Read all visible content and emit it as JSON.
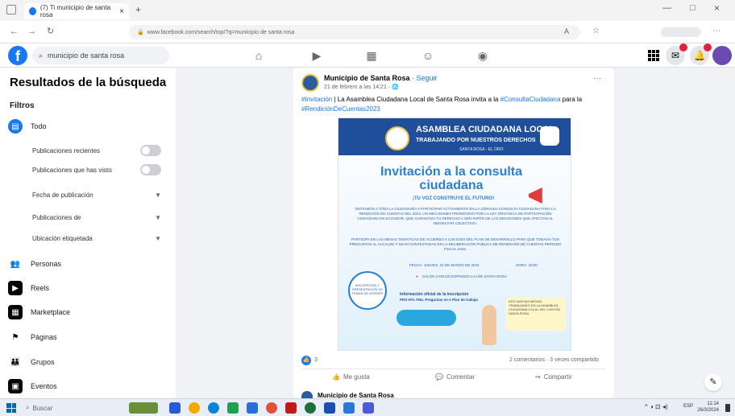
{
  "browser": {
    "tab_title": "(7) Ti municipio de santa rosa",
    "url": "www.facebook.com/search/top/?q=municipio de santa rosa",
    "close_glyph": "×",
    "new_tab_glyph": "+"
  },
  "fb": {
    "logo": "f",
    "search_value": "municipio de santa rosa"
  },
  "sidebar": {
    "title": "Resultados de la búsqueda",
    "filters_label": "Filtros",
    "all_label": "Todo",
    "sub_filters": [
      {
        "label": "Publicaciones recientes",
        "control": "toggle"
      },
      {
        "label": "Publicaciones que has visto",
        "control": "toggle"
      },
      {
        "label": "Fecha de publicación",
        "control": "chevron"
      },
      {
        "label": "Publicaciones de",
        "control": "chevron"
      },
      {
        "label": "Ubicación etiquetada",
        "control": "chevron"
      }
    ],
    "categories": [
      {
        "label": "Personas",
        "icon": "people-icon"
      },
      {
        "label": "Reels",
        "icon": "reels-icon"
      },
      {
        "label": "Marketplace",
        "icon": "marketplace-icon"
      },
      {
        "label": "Páginas",
        "icon": "flag-icon"
      },
      {
        "label": "Grupos",
        "icon": "groups-icon"
      },
      {
        "label": "Eventos",
        "icon": "calendar-icon"
      }
    ]
  },
  "post": {
    "page_name": "Municipio de Santa Rosa",
    "follow_label": "· Seguir",
    "date": "21 de febrero a las 14:21 · 🌐",
    "more_glyph": "···",
    "text_tag1": "#Invitación",
    "text_body": " | La Asamblea Ciudadana Local de Santa Rosa invita a la ",
    "text_tag2": "#ConsultaCiudadana",
    "text_mid": " para la ",
    "text_tag3": "#RendiciónDeCuentas2023",
    "flyer": {
      "title": "ASAMBLEA CIUDADANA LOCAL",
      "subtitle": "TRABAJANDO POR NUESTROS DERECHOS",
      "location": "SANTA ROSA - EL ORO",
      "heading_line1": "Invitación a la consulta",
      "heading_line2": "ciudadana",
      "slogan": "¡TU VOZ CONSTRUYE EL FUTURO!",
      "para1": "INVITAMOS A TODA LA CIUDADANÍA A PARTICIPAR ACTIVAMENTE EN LA JORNADA CONSULTA CIUDADANA PARA LA RENDICIÓN DE CUENTAS DEL 2023, UN MECANISMO PROMOVIDO POR LA LEY ORGÁNICA DE PARTICIPACIÓN CIUDADANA EN ECUADOR, QUE GARANTIZA TU DERECHO A SER PARTE DE LAS DECISIONES QUE AFECTAN AL BIENESTAR COLECTIVO.",
      "para2": "PARTICIPA EN LAS MESAS TEMÁTICAS DE ACUERDO A LOS EJES DEL PLAN DE DESARROLLO PARA QUE TODAVÍA TUS PREGUNTAS AL ALCALDE Y SEAN CONTESTADAS EN LA DELIBERACIÓN PÚBLICA DE RENDICIÓN DE CUENTAS PERIODO FISCAL 2023.",
      "date_line": "FECHA: JUEVES, 21 DE MARZO DE 2024",
      "time_line": "HORA: 18:00",
      "place_line": "SALÓN CARLOS ESPINOZA LAJ DE SANTA ROSA",
      "circle_text": "INSCRIPCIÓN Y PRESENTACIÓN DE TEMAS DE INTERÉS",
      "link_title": "Información oficial de la inscripción",
      "link_sub": "PDS HTL FIEL Preguntas en e Plan de trabajo",
      "box_text": "DOS NUEVAS MESAS: TRABAJANDO EN LA ASAMBLEA CIUDADANA LOCAL DEL CANTÓN SANTA ROSA"
    },
    "reactions_count": "3",
    "stats_right": "2 comentarios · 3 veces compartido",
    "actions": [
      "Me gusta",
      "Comentar",
      "Compartir"
    ],
    "next_page_name": "Municipio de Santa Rosa"
  },
  "taskbar": {
    "search_label": "Buscar",
    "lang": "ESP",
    "time": "11:14",
    "date": "26/3/2024"
  }
}
